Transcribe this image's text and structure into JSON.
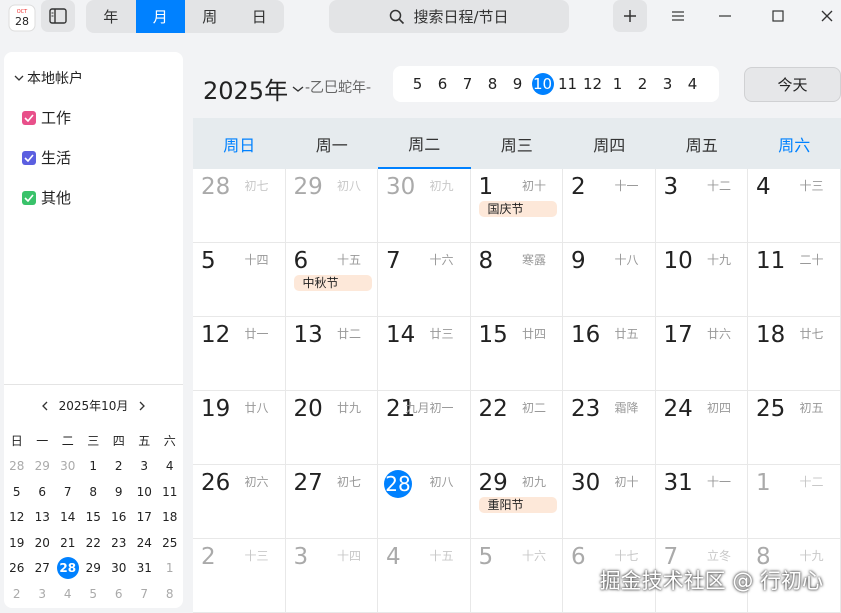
{
  "app_icon": {
    "month": "OCT",
    "day": "28"
  },
  "views": [
    "年",
    "月",
    "周",
    "日"
  ],
  "active_view": "月",
  "search": {
    "label": "搜索日程/节日"
  },
  "sidebar": {
    "account": "本地帐户",
    "calendars": [
      {
        "label": "工作",
        "color": "#e8508a"
      },
      {
        "label": "生活",
        "color": "#5b5fe0"
      },
      {
        "label": "其他",
        "color": "#39c26a"
      }
    ],
    "mini_title": "2025年10月",
    "mini_weekdays": [
      "日",
      "一",
      "二",
      "三",
      "四",
      "五",
      "六"
    ],
    "mini_days": [
      [
        "28",
        "29",
        "30",
        "1",
        "2",
        "3",
        "4"
      ],
      [
        "5",
        "6",
        "7",
        "8",
        "9",
        "10",
        "11"
      ],
      [
        "12",
        "13",
        "14",
        "15",
        "16",
        "17",
        "18"
      ],
      [
        "19",
        "20",
        "21",
        "22",
        "23",
        "24",
        "25"
      ],
      [
        "26",
        "27",
        "28",
        "29",
        "30",
        "31",
        "1"
      ],
      [
        "2",
        "3",
        "4",
        "5",
        "6",
        "7",
        "8"
      ]
    ]
  },
  "year": "2025年",
  "ganzhi": "-乙巳蛇年-",
  "month_strip": [
    "5",
    "6",
    "7",
    "8",
    "9",
    "10",
    "11",
    "12",
    "1",
    "2",
    "3",
    "4"
  ],
  "selected_month": "10",
  "today_label": "今天",
  "weekdays": [
    "周日",
    "周一",
    "周二",
    "周三",
    "周四",
    "周五",
    "周六"
  ],
  "weeks": [
    [
      {
        "d": "28",
        "l": "初七",
        "dim": true
      },
      {
        "d": "29",
        "l": "初八",
        "dim": true
      },
      {
        "d": "30",
        "l": "初九",
        "dim": true
      },
      {
        "d": "1",
        "l": "初十",
        "ev": "国庆节"
      },
      {
        "d": "2",
        "l": "十一"
      },
      {
        "d": "3",
        "l": "十二"
      },
      {
        "d": "4",
        "l": "十三"
      }
    ],
    [
      {
        "d": "5",
        "l": "十四"
      },
      {
        "d": "6",
        "l": "十五",
        "ev": "中秋节"
      },
      {
        "d": "7",
        "l": "十六"
      },
      {
        "d": "8",
        "l": "寒露"
      },
      {
        "d": "9",
        "l": "十八"
      },
      {
        "d": "10",
        "l": "十九"
      },
      {
        "d": "11",
        "l": "二十"
      }
    ],
    [
      {
        "d": "12",
        "l": "廿一"
      },
      {
        "d": "13",
        "l": "廿二"
      },
      {
        "d": "14",
        "l": "廿三"
      },
      {
        "d": "15",
        "l": "廿四"
      },
      {
        "d": "16",
        "l": "廿五"
      },
      {
        "d": "17",
        "l": "廿六"
      },
      {
        "d": "18",
        "l": "廿七"
      }
    ],
    [
      {
        "d": "19",
        "l": "廿八"
      },
      {
        "d": "20",
        "l": "廿九"
      },
      {
        "d": "21",
        "l": "九月初一"
      },
      {
        "d": "22",
        "l": "初二"
      },
      {
        "d": "23",
        "l": "霜降"
      },
      {
        "d": "24",
        "l": "初四"
      },
      {
        "d": "25",
        "l": "初五"
      }
    ],
    [
      {
        "d": "26",
        "l": "初六"
      },
      {
        "d": "27",
        "l": "初七"
      },
      {
        "d": "28",
        "l": "初八",
        "today": true
      },
      {
        "d": "29",
        "l": "初九",
        "ev": "重阳节"
      },
      {
        "d": "30",
        "l": "初十"
      },
      {
        "d": "31",
        "l": "十一"
      },
      {
        "d": "1",
        "l": "十二",
        "dim": true
      }
    ],
    [
      {
        "d": "2",
        "l": "十三",
        "dim": true
      },
      {
        "d": "3",
        "l": "十四",
        "dim": true
      },
      {
        "d": "4",
        "l": "十五",
        "dim": true
      },
      {
        "d": "5",
        "l": "十六",
        "dim": true
      },
      {
        "d": "6",
        "l": "十七",
        "dim": true
      },
      {
        "d": "7",
        "l": "立冬",
        "dim": true
      },
      {
        "d": "8",
        "l": "十九",
        "dim": true
      }
    ]
  ],
  "watermark": "掘金技术社区 @ 行初心"
}
